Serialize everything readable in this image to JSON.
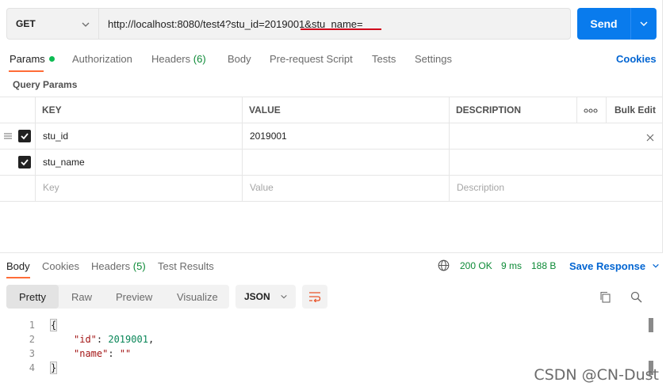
{
  "request": {
    "method": "GET",
    "url": "http://localhost:8080/test4?stu_id=2019001&stu_name=",
    "send_label": "Send"
  },
  "tabs": {
    "params": "Params",
    "authorization": "Authorization",
    "headers": "Headers",
    "headers_count": "(6)",
    "body": "Body",
    "prerequest": "Pre-request Script",
    "tests": "Tests",
    "settings": "Settings",
    "cookies": "Cookies"
  },
  "query_params": {
    "section_label": "Query Params",
    "columns": {
      "key": "KEY",
      "value": "VALUE",
      "description": "DESCRIPTION",
      "more": "ooo",
      "bulk_edit": "Bulk Edit"
    },
    "rows": [
      {
        "key": "stu_id",
        "value": "2019001",
        "checked": true
      },
      {
        "key": "stu_name",
        "value": "",
        "checked": true
      }
    ],
    "placeholders": {
      "key": "Key",
      "value": "Value",
      "description": "Description"
    }
  },
  "response": {
    "tabs": {
      "body": "Body",
      "cookies": "Cookies",
      "headers": "Headers",
      "headers_count": "(5)",
      "test_results": "Test Results"
    },
    "status": "200 OK",
    "time": "9 ms",
    "size": "188 B",
    "save_label": "Save Response",
    "view_modes": [
      "Pretty",
      "Raw",
      "Preview",
      "Visualize"
    ],
    "format": "JSON",
    "code": {
      "open": "{",
      "id_key": "\"id\"",
      "id_value": "2019001",
      "name_key": "\"name\"",
      "name_value": "\"\"",
      "close": "}"
    },
    "line_numbers": [
      "1",
      "2",
      "3",
      "4"
    ]
  },
  "watermark": "CSDN @CN-Dust",
  "colors": {
    "accent": "#ff6c37",
    "send": "#097bed",
    "link": "#0265d2",
    "success": "#0c8a36"
  }
}
